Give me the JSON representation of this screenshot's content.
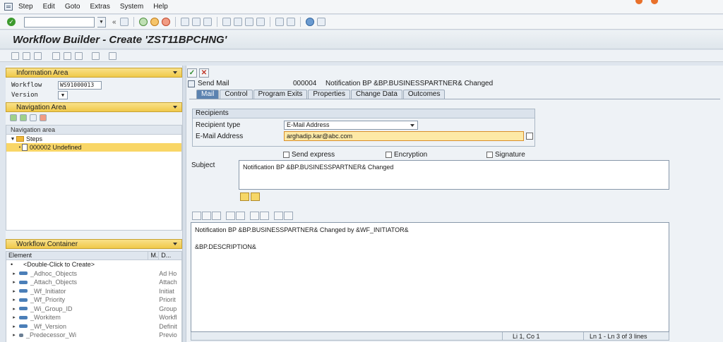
{
  "menu": [
    "Step",
    "Edit",
    "Goto",
    "Extras",
    "System",
    "Help"
  ],
  "title": "Workflow Builder - Create 'ZST11BPCHNG'",
  "left": {
    "info_area_title": "Information Area",
    "workflow_label": "Workflow",
    "workflow_value": "WS91000013",
    "version_label": "Version",
    "nav_area_title": "Navigation Area",
    "nav_column": "Navigation area",
    "tree": {
      "root": "Steps",
      "child": "000002 Undefined"
    },
    "container_title": "Workflow Container",
    "container_columns": [
      "Element",
      "M.",
      "D..."
    ],
    "container_rows": [
      {
        "element": "<Double-Click to Create>",
        "desc": ""
      },
      {
        "element": "_Adhoc_Objects",
        "desc": "Ad Ho"
      },
      {
        "element": "_Attach_Objects",
        "desc": "Attach"
      },
      {
        "element": "_Wf_Initiator",
        "desc": "Initiat"
      },
      {
        "element": "_Wf_Priority",
        "desc": "Priorit"
      },
      {
        "element": "_Wi_Group_ID",
        "desc": "Group"
      },
      {
        "element": "_Workitem",
        "desc": "Workfl"
      },
      {
        "element": "_Wf_Version",
        "desc": "Definit"
      },
      {
        "element": "_Predecessor_Wi",
        "desc": "Previo"
      }
    ]
  },
  "step": {
    "type": "Send Mail",
    "number": "000004",
    "description": "Notification BP &BP.BUSINESSPARTNER& Changed"
  },
  "tabs": [
    "Mail",
    "Control",
    "Program Exits",
    "Properties",
    "Change Data",
    "Outcomes"
  ],
  "recipients": {
    "title": "Recipients",
    "type_label": "Recipient type",
    "type_value": "E-Mail Address",
    "email_label": "E-Mail Address",
    "email_value": "arghadip.kar@abc.com"
  },
  "options": {
    "send_express": "Send express",
    "encryption": "Encryption",
    "signature": "Signature"
  },
  "subject": {
    "label": "Subject",
    "value": "Notification BP &BP.BUSINESSPARTNER& Changed"
  },
  "body": {
    "line1": "Notification BP &BP.BUSINESSPARTNER& Changed by &WF_INITIATOR&",
    "line2": "",
    "line3": "&BP.DESCRIPTION&"
  },
  "status": {
    "position": "Li 1, Co 1",
    "lines": "Ln 1 - Ln 3 of 3 lines"
  }
}
